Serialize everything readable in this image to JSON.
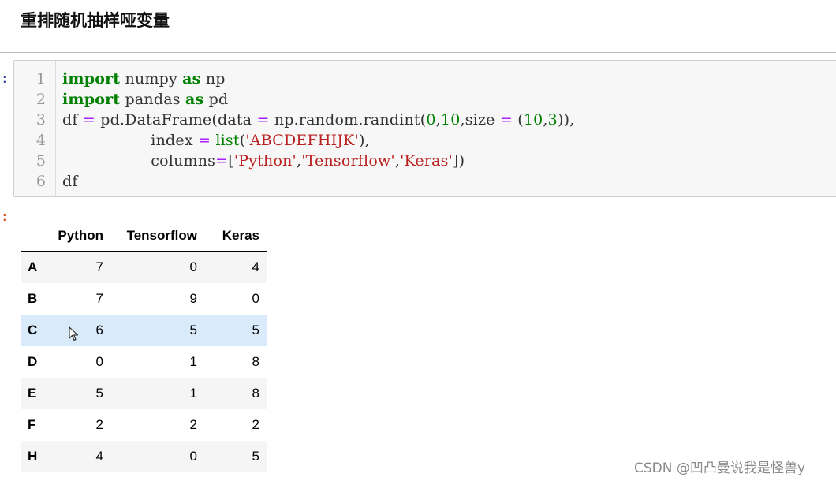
{
  "heading": "重排随机抽样哑变量",
  "prompts": {
    "input": ":",
    "output": ":"
  },
  "code": {
    "line_numbers": [
      "1",
      "2",
      "3",
      "4",
      "5",
      "6"
    ],
    "line1": {
      "kw1": "import",
      "mod": " numpy ",
      "kw2": "as",
      "alias": " np"
    },
    "line2": {
      "kw1": "import",
      "mod": " pandas ",
      "kw2": "as",
      "alias": " pd"
    },
    "line3": {
      "a": "df ",
      "eq1": "=",
      "b": " pd.DataFrame(data ",
      "eq2": "=",
      "c": " np.random.randint(",
      "n0": "0",
      "c1": ",",
      "n10": "10",
      "c2": ",size ",
      "eq3": "=",
      "c3": " (",
      "n10b": "10",
      "c4": ",",
      "n3": "3",
      "c5": ")),"
    },
    "line4": {
      "indent": "                  index ",
      "eq": "=",
      "sp": " ",
      "bi": "list",
      "p1": "(",
      "s": "'ABCDEFHIJK'",
      "p2": "),"
    },
    "line5": {
      "indent": "                  columns",
      "eq": "=",
      "b1": "[",
      "s1": "'Python'",
      "c1": ",",
      "s2": "'Tensorflow'",
      "c2": ",",
      "s3": "'Keras'",
      "b2": "])"
    },
    "line6": {
      "text": "df"
    }
  },
  "table": {
    "columns": [
      "Python",
      "Tensorflow",
      "Keras"
    ],
    "rows": [
      {
        "index": "A",
        "values": [
          "7",
          "0",
          "4"
        ]
      },
      {
        "index": "B",
        "values": [
          "7",
          "9",
          "0"
        ]
      },
      {
        "index": "C",
        "values": [
          "6",
          "5",
          "5"
        ]
      },
      {
        "index": "D",
        "values": [
          "0",
          "1",
          "8"
        ]
      },
      {
        "index": "E",
        "values": [
          "5",
          "1",
          "8"
        ]
      },
      {
        "index": "F",
        "values": [
          "2",
          "2",
          "2"
        ]
      },
      {
        "index": "H",
        "values": [
          "4",
          "0",
          "5"
        ]
      }
    ],
    "hovered_row": "C"
  },
  "watermark": "CSDN @凹凸曼说我是怪兽y",
  "colors": {
    "keyword": "#008000",
    "string": "#ba2121",
    "operator": "#aa22ff",
    "number": "#008000",
    "row_hover": "#d9ebfb",
    "row_stripe": "#f5f5f5",
    "code_bg": "#f7f7f7"
  },
  "icons": {
    "cursor": "mouse-pointer-icon"
  }
}
